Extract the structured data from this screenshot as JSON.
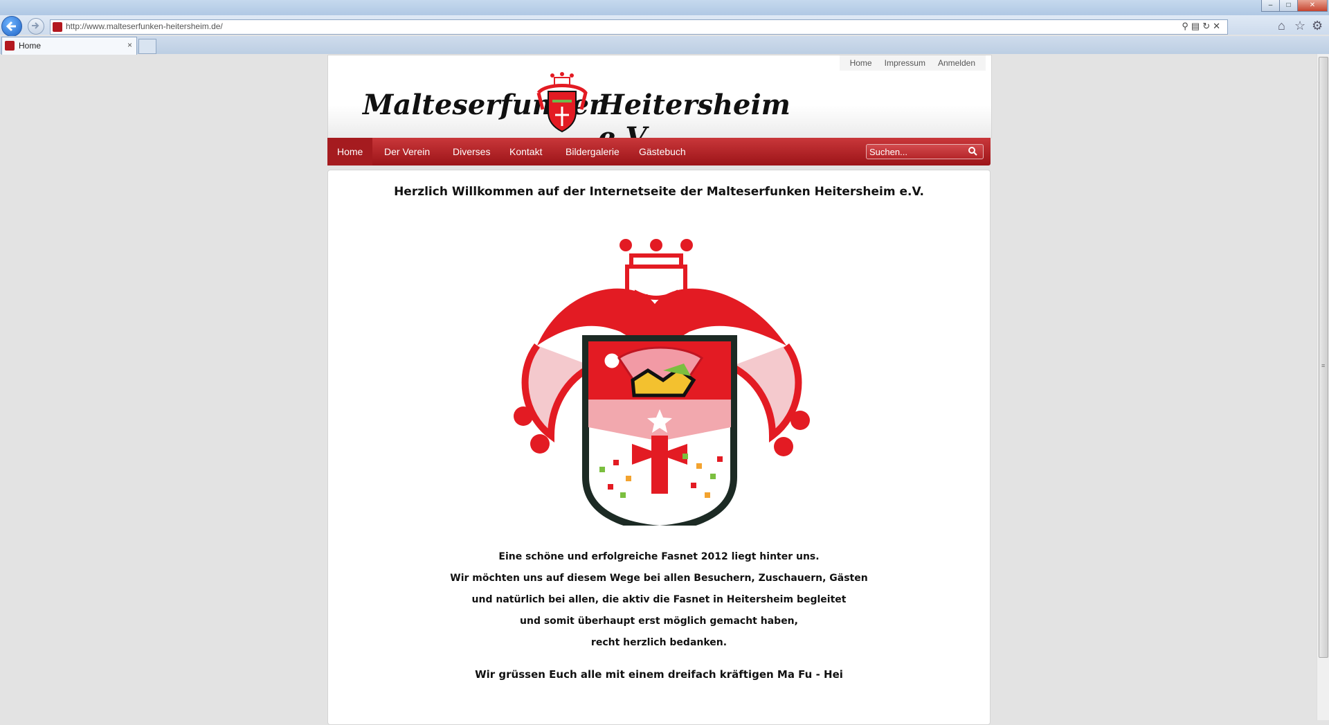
{
  "browser": {
    "url": "http://www.malteserfunken-heitersheim.de/",
    "tab_label": "Home",
    "tab_close": "×",
    "window_buttons": [
      "–",
      "□",
      "✕"
    ]
  },
  "site": {
    "top_links": [
      "Home",
      "Impressum",
      "Anmelden"
    ],
    "brand_left": "Malteserfunken",
    "brand_right": "Heitersheim  e.V.",
    "nav": [
      "Home",
      "Der Verein",
      "Diverses",
      "Kontakt",
      "Bildergalerie",
      "Gästebuch"
    ],
    "search_placeholder": "Suchen...",
    "colors": {
      "nav_red": "#b1242a",
      "crest_red": "#e31b23"
    }
  },
  "content": {
    "welcome": "Herzlich Willkommen auf der Internetseite der Malteserfunken Heitersheim e.V.",
    "message_lines": [
      "Eine schöne und erfolgreiche Fasnet 2012 liegt hinter uns.",
      "Wir möchten uns auf diesem Wege bei allen Besuchern, Zuschauern, Gästen",
      "und natürlich bei allen, die aktiv die Fasnet in Heitersheim begleitet",
      "und somit überhaupt erst möglich gemacht haben,",
      "recht herzlich bedanken."
    ],
    "greeting": "Wir grüssen Euch alle mit einem dreifach kräftigen Ma Fu - Hei"
  }
}
